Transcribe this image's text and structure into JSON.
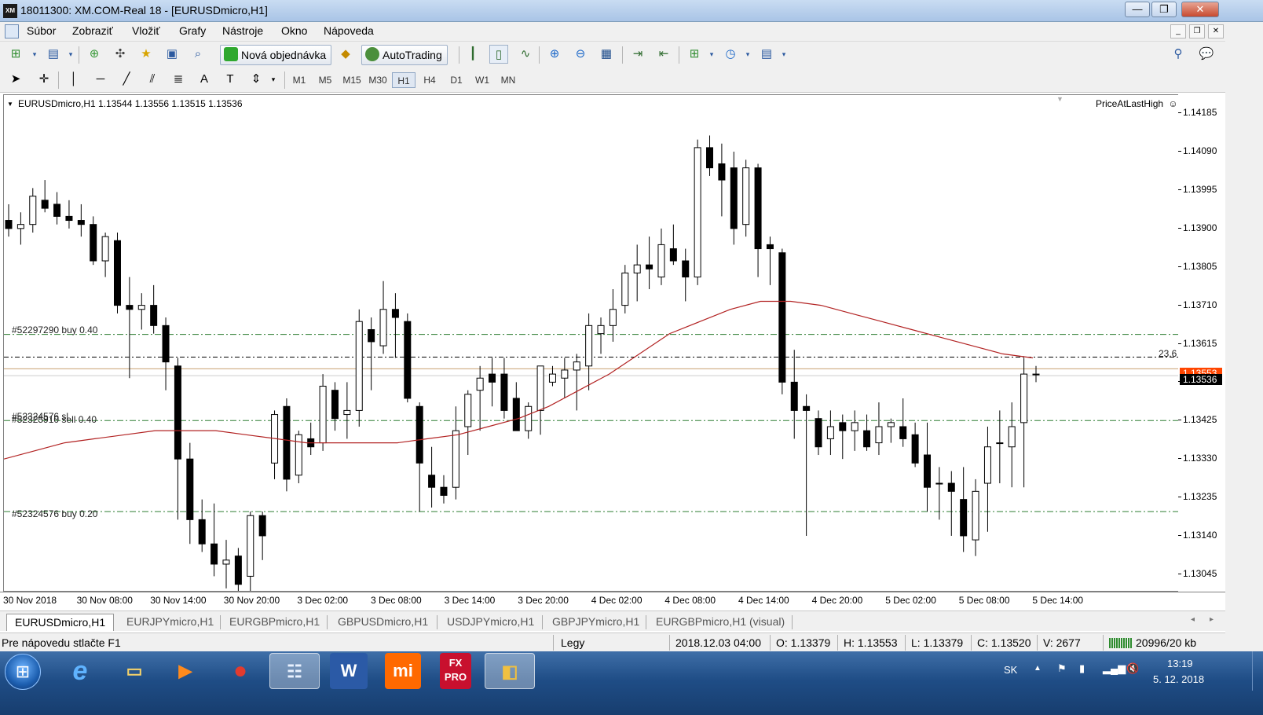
{
  "window": {
    "title": "18011300: XM.COM-Real 18 - [EURUSDmicro,H1]",
    "app_badge": "XM",
    "buttons": {
      "minimize": "—",
      "restore": "❐",
      "close": "✕"
    }
  },
  "menu": {
    "items": [
      {
        "label": "Súbor"
      },
      {
        "label": "Zobraziť"
      },
      {
        "label": "Vložiť"
      },
      {
        "label": "Grafy"
      },
      {
        "label": "Nástroje"
      },
      {
        "label": "Okno"
      },
      {
        "label": "Nápoveda"
      }
    ]
  },
  "toolbar": {
    "new_order_label": "Nová objednávka",
    "autotrading_label": "AutoTrading",
    "timeframes": [
      "M1",
      "M5",
      "M15",
      "M30",
      "H1",
      "H4",
      "D1",
      "W1",
      "MN"
    ],
    "active_timeframe": "H1"
  },
  "chart": {
    "header": "EURUSDmicro,H1  1.13544 1.13556 1.13515 1.13536",
    "indicator_name": "PriceAtLastHigh",
    "fib_label": "23.6",
    "order_labels": {
      "buy1": "#52297290 buy 0.40",
      "sell": "#52324576 sl",
      "sell2": "#52325910 sell 0.40",
      "buy2": "#52324576 buy 0.20"
    },
    "current_price": "1.13536",
    "ask_price": "1.13553",
    "colors": {
      "bull": "#ffffff",
      "bear": "#000000",
      "ma": "#b22222",
      "order_line": "#2e7d32",
      "price_line": "#c8a070",
      "fib_line": "#000000",
      "ask_badge": "#ff4500",
      "bid_badge": "#000000"
    }
  },
  "chart_data": {
    "type": "candlestick",
    "title": "EURUSDmicro,H1",
    "ylim": [
      1.13,
      1.1423
    ],
    "y_ticks": [
      "1.14185",
      "1.14090",
      "1.13995",
      "1.13900",
      "1.13805",
      "1.13710",
      "1.13615",
      "1.13520",
      "1.13425",
      "1.13330",
      "1.13235",
      "1.13140",
      "1.13045"
    ],
    "x_labels": [
      "30 Nov 2018",
      "30 Nov 08:00",
      "30 Nov 14:00",
      "30 Nov 20:00",
      "3 Dec 02:00",
      "3 Dec 08:00",
      "3 Dec 14:00",
      "3 Dec 20:00",
      "4 Dec 02:00",
      "4 Dec 08:00",
      "4 Dec 14:00",
      "4 Dec 20:00",
      "5 Dec 02:00",
      "5 Dec 08:00",
      "5 Dec 14:00"
    ],
    "candles": [
      [
        1.1392,
        1.1396,
        1.1388,
        1.139
      ],
      [
        1.139,
        1.1394,
        1.1386,
        1.1391
      ],
      [
        1.1391,
        1.14,
        1.1389,
        1.1398
      ],
      [
        1.1397,
        1.1402,
        1.1394,
        1.1395
      ],
      [
        1.1396,
        1.1399,
        1.1391,
        1.1393
      ],
      [
        1.1393,
        1.1397,
        1.139,
        1.1392
      ],
      [
        1.1392,
        1.1396,
        1.1388,
        1.1391
      ],
      [
        1.1391,
        1.1393,
        1.1381,
        1.1382
      ],
      [
        1.1382,
        1.1389,
        1.1378,
        1.1388
      ],
      [
        1.1387,
        1.1389,
        1.1369,
        1.1371
      ],
      [
        1.1371,
        1.1378,
        1.1353,
        1.137
      ],
      [
        1.137,
        1.1374,
        1.1365,
        1.1371
      ],
      [
        1.1371,
        1.1376,
        1.1364,
        1.1366
      ],
      [
        1.1366,
        1.1368,
        1.135,
        1.1357
      ],
      [
        1.1356,
        1.1358,
        1.1318,
        1.1333
      ],
      [
        1.1333,
        1.1337,
        1.1312,
        1.1318
      ],
      [
        1.1318,
        1.1323,
        1.131,
        1.1312
      ],
      [
        1.1312,
        1.1322,
        1.1304,
        1.1307
      ],
      [
        1.1307,
        1.1313,
        1.1301,
        1.1308
      ],
      [
        1.1309,
        1.1311,
        1.1295,
        1.1302
      ],
      [
        1.1304,
        1.132,
        1.1299,
        1.1319
      ],
      [
        1.1319,
        1.132,
        1.1308,
        1.1314
      ],
      [
        1.1332,
        1.1345,
        1.1328,
        1.1344
      ],
      [
        1.1346,
        1.1348,
        1.1325,
        1.1328
      ],
      [
        1.1329,
        1.134,
        1.1327,
        1.1339
      ],
      [
        1.1338,
        1.1342,
        1.1334,
        1.1336
      ],
      [
        1.1337,
        1.1354,
        1.1335,
        1.1351
      ],
      [
        1.135,
        1.1352,
        1.134,
        1.1343
      ],
      [
        1.1344,
        1.1352,
        1.1338,
        1.1345
      ],
      [
        1.1345,
        1.137,
        1.1341,
        1.1367
      ],
      [
        1.1365,
        1.1368,
        1.135,
        1.1362
      ],
      [
        1.1361,
        1.1377,
        1.1359,
        1.137
      ],
      [
        1.137,
        1.1374,
        1.1358,
        1.1368
      ],
      [
        1.1367,
        1.1369,
        1.1347,
        1.1348
      ],
      [
        1.1346,
        1.1347,
        1.132,
        1.1332
      ],
      [
        1.1329,
        1.1336,
        1.1321,
        1.1326
      ],
      [
        1.1326,
        1.1329,
        1.1322,
        1.1324
      ],
      [
        1.1326,
        1.1346,
        1.1323,
        1.134
      ],
      [
        1.1341,
        1.135,
        1.1334,
        1.1349
      ],
      [
        1.135,
        1.1356,
        1.134,
        1.1353
      ],
      [
        1.1354,
        1.1358,
        1.1346,
        1.1352
      ],
      [
        1.1354,
        1.1358,
        1.1343,
        1.1345
      ],
      [
        1.1348,
        1.1352,
        1.1341,
        1.134
      ],
      [
        1.134,
        1.1347,
        1.1338,
        1.1346
      ],
      [
        1.1345,
        1.1355,
        1.1339,
        1.1356
      ],
      [
        1.1352,
        1.1356,
        1.1351,
        1.1354
      ],
      [
        1.1353,
        1.1358,
        1.1348,
        1.1355
      ],
      [
        1.1355,
        1.1359,
        1.1345,
        1.1357
      ],
      [
        1.1356,
        1.1369,
        1.135,
        1.1366
      ],
      [
        1.1364,
        1.1368,
        1.1359,
        1.1366
      ],
      [
        1.1366,
        1.1375,
        1.1362,
        1.137
      ],
      [
        1.1371,
        1.1381,
        1.1369,
        1.1379
      ],
      [
        1.1379,
        1.1386,
        1.1372,
        1.1381
      ],
      [
        1.1381,
        1.1388,
        1.1375,
        1.138
      ],
      [
        1.1378,
        1.139,
        1.1376,
        1.1386
      ],
      [
        1.1385,
        1.1391,
        1.1381,
        1.1382
      ],
      [
        1.1382,
        1.1385,
        1.1372,
        1.1378
      ],
      [
        1.1378,
        1.1412,
        1.1376,
        1.141
      ],
      [
        1.141,
        1.1413,
        1.1403,
        1.1405
      ],
      [
        1.1406,
        1.1411,
        1.1393,
        1.1402
      ],
      [
        1.1405,
        1.1409,
        1.1386,
        1.139
      ],
      [
        1.1391,
        1.1407,
        1.1388,
        1.1405
      ],
      [
        1.1405,
        1.1406,
        1.1378,
        1.1385
      ],
      [
        1.1386,
        1.1388,
        1.1376,
        1.1385
      ],
      [
        1.1384,
        1.1385,
        1.1349,
        1.1352
      ],
      [
        1.1352,
        1.136,
        1.1338,
        1.1345
      ],
      [
        1.1346,
        1.1349,
        1.1314,
        1.1345
      ],
      [
        1.1343,
        1.1345,
        1.1334,
        1.1336
      ],
      [
        1.1338,
        1.1345,
        1.1334,
        1.1341
      ],
      [
        1.1342,
        1.1344,
        1.1333,
        1.134
      ],
      [
        1.134,
        1.1345,
        1.1335,
        1.1342
      ],
      [
        1.134,
        1.1344,
        1.1335,
        1.1336
      ],
      [
        1.1337,
        1.1347,
        1.1334,
        1.1341
      ],
      [
        1.1341,
        1.1343,
        1.1337,
        1.1342
      ],
      [
        1.1341,
        1.1348,
        1.1336,
        1.1338
      ],
      [
        1.1339,
        1.1342,
        1.1331,
        1.1332
      ],
      [
        1.1334,
        1.1342,
        1.132,
        1.1326
      ],
      [
        1.1327,
        1.1331,
        1.1318,
        1.1327
      ],
      [
        1.1327,
        1.133,
        1.1314,
        1.1325
      ],
      [
        1.1323,
        1.1331,
        1.131,
        1.1314
      ],
      [
        1.1313,
        1.1328,
        1.1309,
        1.1325
      ],
      [
        1.1327,
        1.1341,
        1.1315,
        1.1336
      ],
      [
        1.1337,
        1.1345,
        1.1327,
        1.1337
      ],
      [
        1.1336,
        1.1347,
        1.1326,
        1.1341
      ],
      [
        1.1342,
        1.1358,
        1.1326,
        1.1354
      ],
      [
        1.1354,
        1.1356,
        1.1352,
        1.1354
      ]
    ],
    "levels": [
      {
        "name": "#52297290 buy 0.40",
        "value": 1.13638,
        "style": "order"
      },
      {
        "name": "23.6",
        "value": 1.13582,
        "style": "fib"
      },
      {
        "name": "1.13553",
        "value": 1.13553,
        "style": "ask"
      },
      {
        "name": "1.13536",
        "value": 1.13536,
        "style": "bid"
      },
      {
        "name": "#52325910 sell 0.40",
        "value": 1.13425,
        "style": "order"
      },
      {
        "name": "#52324576 buy 0.20",
        "value": 1.132,
        "style": "order"
      }
    ],
    "ma": [
      1.1333,
      1.1335,
      1.1337,
      1.1338,
      1.1339,
      1.134,
      1.134,
      1.134,
      1.1339,
      1.1338,
      1.1337,
      1.1337,
      1.1337,
      1.1337,
      1.1338,
      1.1339,
      1.1341,
      1.1343,
      1.1346,
      1.135,
      1.1354,
      1.1359,
      1.1364,
      1.1367,
      1.137,
      1.1372,
      1.1372,
      1.1371,
      1.1369,
      1.1367,
      1.1365,
      1.1363,
      1.1361,
      1.1359,
      1.1358
    ]
  },
  "tabs": [
    {
      "label": "EURUSDmicro,H1"
    },
    {
      "label": "EURJPYmicro,H1"
    },
    {
      "label": "EURGBPmicro,H1"
    },
    {
      "label": "GBPUSDmicro,H1"
    },
    {
      "label": "USDJPYmicro,H1"
    },
    {
      "label": "GBPJPYmicro,H1"
    },
    {
      "label": "EURGBPmicro,H1 (visual)"
    }
  ],
  "status": {
    "help": "Pre nápovedu stlačte F1",
    "profile": "Legy",
    "datetime": "2018.12.03 04:00",
    "open": "O: 1.13379",
    "high": "H: 1.13553",
    "low": "L: 1.13379",
    "close": "C: 1.13520",
    "volume": "V: 2677",
    "traffic": "20996/20 kb"
  },
  "taskbar": {
    "apps": [
      {
        "name": "internet-explorer",
        "glyph": "e"
      },
      {
        "name": "file-explorer",
        "glyph": "▭"
      },
      {
        "name": "media-player",
        "glyph": "▶"
      },
      {
        "name": "chrome",
        "glyph": "●"
      },
      {
        "name": "network-app",
        "glyph": "☷"
      },
      {
        "name": "word",
        "glyph": "W"
      },
      {
        "name": "mi",
        "glyph": "mi"
      },
      {
        "name": "fxpro",
        "glyph": "FX PRO"
      },
      {
        "name": "metatrader",
        "glyph": "◧"
      }
    ],
    "lang": "SK",
    "time": "13:19",
    "date": "5. 12. 2018"
  }
}
